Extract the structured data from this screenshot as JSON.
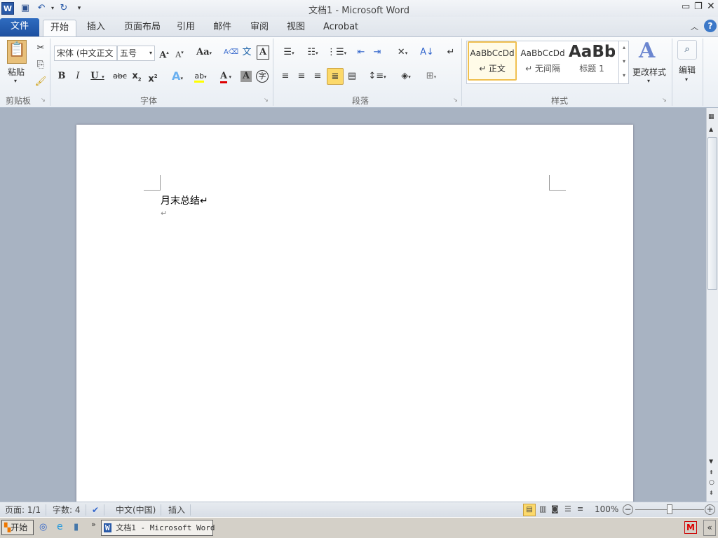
{
  "window": {
    "title": "文档1  -  Microsoft Word"
  },
  "qat": {
    "word_icon": "W",
    "save": "save-icon",
    "undo": "undo-icon",
    "redo": "redo-icon"
  },
  "tabs": [
    {
      "label": "文件"
    },
    {
      "label": "开始"
    },
    {
      "label": "插入"
    },
    {
      "label": "页面布局"
    },
    {
      "label": "引用"
    },
    {
      "label": "邮件"
    },
    {
      "label": "审阅"
    },
    {
      "label": "视图"
    },
    {
      "label": "Acrobat"
    }
  ],
  "ribbon": {
    "clipboard": {
      "label": "剪贴板",
      "paste": "粘贴"
    },
    "font": {
      "label": "字体",
      "font_name": "宋体 (中文正文",
      "font_size": "五号"
    },
    "paragraph": {
      "label": "段落"
    },
    "styles": {
      "label": "样式",
      "items": [
        {
          "preview": "AaBbCcDd",
          "name": "↵ 正文"
        },
        {
          "preview": "AaBbCcDd",
          "name": "↵ 无间隔"
        },
        {
          "preview": "AaBb",
          "name": "标题 1"
        }
      ],
      "change": "更改样式"
    },
    "editing": {
      "label": "编辑"
    }
  },
  "document": {
    "lines": [
      "月末总结↵",
      "↵"
    ]
  },
  "status": {
    "page": "页面: 1/1",
    "words": "字数: 4",
    "language": "中文(中国)",
    "mode": "插入",
    "zoom": "100%",
    "zoom_level": 0.5
  },
  "taskbar": {
    "start": "开始",
    "window": "文档1 - Microsoft Word"
  }
}
